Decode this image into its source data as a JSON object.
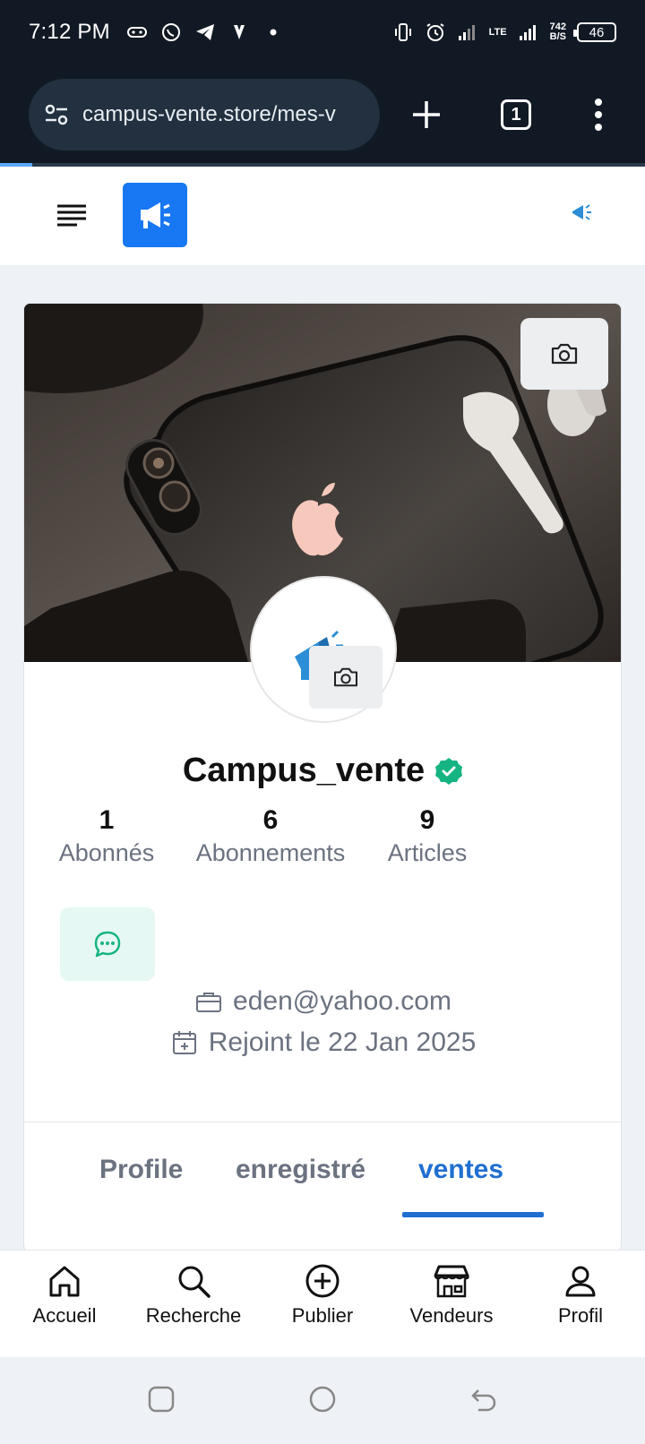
{
  "status_bar": {
    "time": "7:12 PM",
    "network_rate": "742",
    "network_unit": "B/S",
    "lte": "LTE",
    "battery": "46",
    "icons": [
      "game-controller-icon",
      "whatsapp-icon",
      "telegram-icon",
      "vlc-icon",
      "dot-icon",
      "vibrate-icon",
      "alarm-icon",
      "signal-icon",
      "lte-signal-icon"
    ]
  },
  "browser": {
    "url": "campus-vente.store/mes-v",
    "tab_count": "1",
    "icons": [
      "site-settings-icon",
      "new-tab-icon",
      "tab-switcher-icon",
      "more-menu-icon"
    ]
  },
  "header": {
    "icons": [
      "hamburger-menu-icon",
      "megaphone-logo-icon",
      "mini-logo-icon"
    ],
    "accent_color": "#1877f2"
  },
  "profile": {
    "username": "Campus_vente",
    "verified_color": "#16b483",
    "stats": [
      {
        "value": "1",
        "label": "Abonnés"
      },
      {
        "value": "6",
        "label": "Abonnements"
      },
      {
        "value": "9",
        "label": "Articles"
      }
    ],
    "email": "eden@yahoo.com",
    "joined": "Rejoint le 22 Jan 2025"
  },
  "tabs": [
    {
      "label": "Profile",
      "active": false
    },
    {
      "label": "enregistré",
      "active": false
    },
    {
      "label": "ventes",
      "active": true
    }
  ],
  "bottom_nav": [
    {
      "label": "Accueil",
      "icon": "home-icon"
    },
    {
      "label": "Recherche",
      "icon": "search-icon"
    },
    {
      "label": "Publier",
      "icon": "plus-circle-icon"
    },
    {
      "label": "Vendeurs",
      "icon": "store-icon"
    },
    {
      "label": "Profil",
      "icon": "user-icon"
    }
  ],
  "colors": {
    "primary_blue": "#1f6fd1",
    "message_bg": "#e6f8f3",
    "message_icon": "#16b483"
  }
}
